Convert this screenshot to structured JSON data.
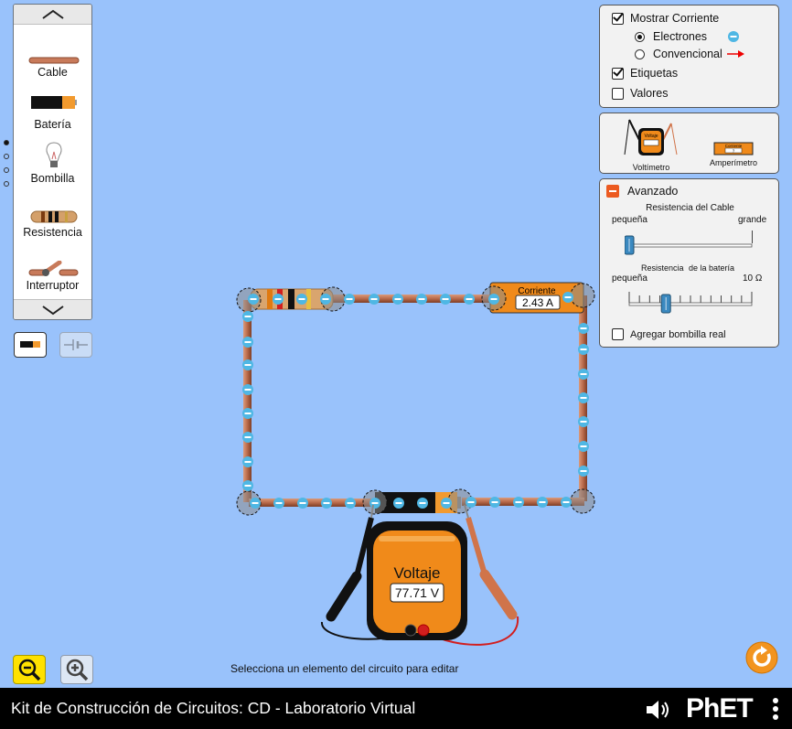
{
  "palette": {
    "items": [
      {
        "label": "Cable",
        "icon": "wire-icon"
      },
      {
        "label": "Batería",
        "icon": "battery-icon"
      },
      {
        "label": "Bombilla",
        "icon": "light-bulb-icon"
      },
      {
        "label": "Resistencia",
        "icon": "resistor-icon"
      },
      {
        "label": "Interruptor",
        "icon": "switch-icon"
      }
    ]
  },
  "display_options": {
    "show_current": "Mostrar Corriente",
    "electrons": "Electrones",
    "conventional": "Convencional",
    "labels": "Etiquetas",
    "values": "Valores"
  },
  "tools": {
    "voltmeter": "Voltímetro",
    "ammeter": "Amperímetro",
    "voltmeter_icon_text": "Voltaje",
    "ammeter_icon_text": "Corriente",
    "ammeter_icon_value": "?"
  },
  "advanced": {
    "title": "Avanzado",
    "wire_resistance": "Resistencia del Cable",
    "small": "pequeña",
    "large": "grande",
    "battery_resistance_1": "Resistencia",
    "battery_resistance_2": "de la batería",
    "small2": "pequeña",
    "battery_max": "10 Ω",
    "real_bulb": "Agregar bombilla real",
    "wire_resistance_fraction": 0.0,
    "battery_resistance_fraction": 0.3
  },
  "ammeter_reading": {
    "label": "Corriente",
    "value": "2.43 A"
  },
  "voltmeter_reading": {
    "label": "Voltaje",
    "value": "77.71 V"
  },
  "status": "Selecciona un elemento del circuito para editar",
  "footer": {
    "title": "Kit de Construcción de Circuitos: CD - Laboratorio Virtual",
    "brand": "PhET"
  },
  "colors": {
    "background": "#99c2fb",
    "electron": "#4fb7e4",
    "wire": "#b86a4b",
    "accent": "#f08a1a",
    "zoom_active": "#ffe100"
  }
}
